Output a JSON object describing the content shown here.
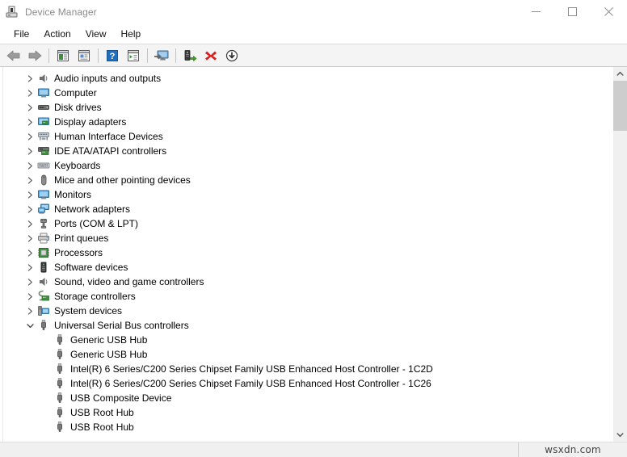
{
  "window": {
    "title": "Device Manager",
    "icon": "device-manager-icon",
    "controls": {
      "minimize": "minimize-icon",
      "maximize": "maximize-icon",
      "close": "close-icon"
    }
  },
  "menubar": {
    "items": [
      {
        "label": "File"
      },
      {
        "label": "Action"
      },
      {
        "label": "View"
      },
      {
        "label": "Help"
      }
    ]
  },
  "toolbar": {
    "buttons": [
      {
        "name": "back-button",
        "icon": "back-arrow-icon"
      },
      {
        "name": "forward-button",
        "icon": "forward-arrow-icon"
      },
      {
        "name": "separator-1",
        "icon": "separator"
      },
      {
        "name": "show-hide-console-tree-button",
        "icon": "console-tree-icon"
      },
      {
        "name": "properties-button",
        "icon": "properties-icon"
      },
      {
        "name": "separator-2",
        "icon": "separator"
      },
      {
        "name": "help-button",
        "icon": "help-question-icon"
      },
      {
        "name": "show-hide-action-pane-button",
        "icon": "action-pane-icon"
      },
      {
        "name": "separator-3",
        "icon": "separator"
      },
      {
        "name": "update-driver-button",
        "icon": "monitor-update-icon"
      },
      {
        "name": "separator-4",
        "icon": "separator"
      },
      {
        "name": "scan-for-hardware-changes-button",
        "icon": "scan-hardware-icon"
      },
      {
        "name": "uninstall-device-button",
        "icon": "red-x-icon"
      },
      {
        "name": "disable-device-button",
        "icon": "down-arrow-circle-icon"
      }
    ]
  },
  "tree": {
    "nodes": [
      {
        "label": "Audio inputs and outputs",
        "icon": "speaker-icon",
        "expanded": false,
        "level": 1
      },
      {
        "label": "Computer",
        "icon": "monitor-icon",
        "expanded": false,
        "level": 1
      },
      {
        "label": "Disk drives",
        "icon": "disk-drive-icon",
        "expanded": false,
        "level": 1
      },
      {
        "label": "Display adapters",
        "icon": "display-adapter-icon",
        "expanded": false,
        "level": 1
      },
      {
        "label": "Human Interface Devices",
        "icon": "hid-icon",
        "expanded": false,
        "level": 1
      },
      {
        "label": "IDE ATA/ATAPI controllers",
        "icon": "ide-controller-icon",
        "expanded": false,
        "level": 1
      },
      {
        "label": "Keyboards",
        "icon": "keyboard-icon",
        "expanded": false,
        "level": 1
      },
      {
        "label": "Mice and other pointing devices",
        "icon": "mouse-icon",
        "expanded": false,
        "level": 1
      },
      {
        "label": "Monitors",
        "icon": "monitor-icon",
        "expanded": false,
        "level": 1
      },
      {
        "label": "Network adapters",
        "icon": "network-adapter-icon",
        "expanded": false,
        "level": 1
      },
      {
        "label": "Ports (COM & LPT)",
        "icon": "port-icon",
        "expanded": false,
        "level": 1
      },
      {
        "label": "Print queues",
        "icon": "printer-icon",
        "expanded": false,
        "level": 1
      },
      {
        "label": "Processors",
        "icon": "processor-chip-icon",
        "expanded": false,
        "level": 1
      },
      {
        "label": "Software devices",
        "icon": "software-device-icon",
        "expanded": false,
        "level": 1
      },
      {
        "label": "Sound, video and game controllers",
        "icon": "speaker-icon",
        "expanded": false,
        "level": 1
      },
      {
        "label": "Storage controllers",
        "icon": "storage-controller-icon",
        "expanded": false,
        "level": 1
      },
      {
        "label": "System devices",
        "icon": "system-device-icon",
        "expanded": false,
        "level": 1
      },
      {
        "label": "Universal Serial Bus controllers",
        "icon": "usb-icon",
        "expanded": true,
        "level": 1
      },
      {
        "label": "Generic USB Hub",
        "icon": "usb-icon",
        "expanded": null,
        "level": 2
      },
      {
        "label": "Generic USB Hub",
        "icon": "usb-icon",
        "expanded": null,
        "level": 2
      },
      {
        "label": "Intel(R) 6 Series/C200 Series Chipset Family USB Enhanced Host Controller - 1C2D",
        "icon": "usb-icon",
        "expanded": null,
        "level": 2
      },
      {
        "label": "Intel(R) 6 Series/C200 Series Chipset Family USB Enhanced Host Controller - 1C26",
        "icon": "usb-icon",
        "expanded": null,
        "level": 2
      },
      {
        "label": "USB Composite Device",
        "icon": "usb-icon",
        "expanded": null,
        "level": 2
      },
      {
        "label": "USB Root Hub",
        "icon": "usb-icon",
        "expanded": null,
        "level": 2
      },
      {
        "label": "USB Root Hub",
        "icon": "usb-icon",
        "expanded": null,
        "level": 2
      }
    ]
  },
  "scrollbar": {
    "up_arrow": "scroll-up-icon",
    "down_arrow": "scroll-down-icon"
  },
  "statusbar": {
    "watermark": "wsxdn.com"
  },
  "colors": {
    "toolbar_bg": "#f4f4f4",
    "statusbar_bg": "#f0f0f0",
    "title_text": "#8a8a8a",
    "accent_blue": "#1e6fbf",
    "uninstall_red": "#d81e1e",
    "scan_green": "#4a9c2d"
  }
}
